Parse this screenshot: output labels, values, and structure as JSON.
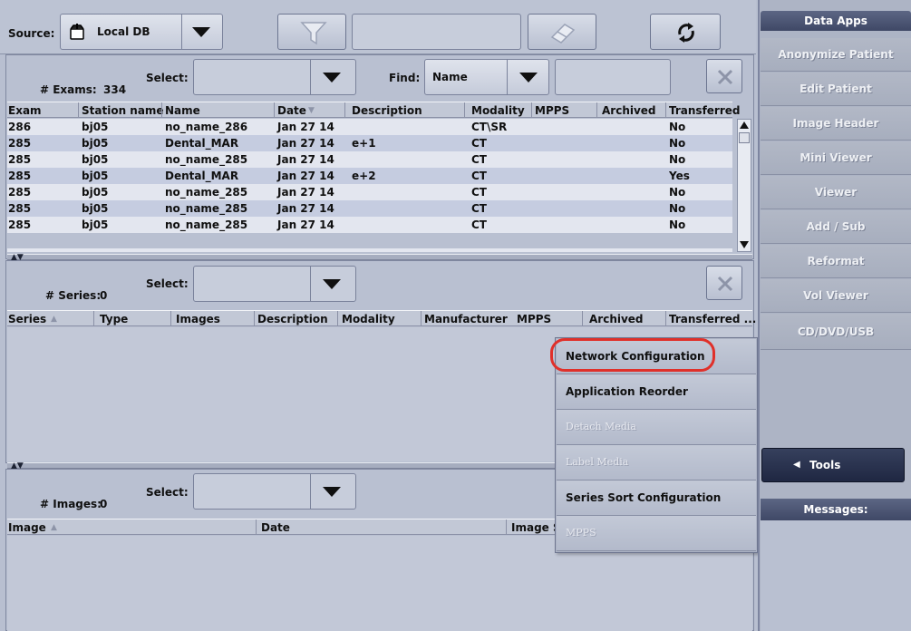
{
  "toolbar": {
    "source_label": "Source:",
    "source_value": "Local DB"
  },
  "exams": {
    "count_label": "# Exams:",
    "count": "334",
    "select_label": "Select:",
    "find_label": "Find:",
    "find_field": "Name",
    "columns": [
      "Exam",
      "Station name",
      "Name",
      "Date",
      "Description",
      "Modality",
      "MPPS",
      "Archived",
      "Transferred"
    ],
    "rows": [
      [
        "286",
        "bj05",
        "no_name_286",
        "Jan 27 14",
        "",
        "CT\\SR",
        "",
        "",
        "No"
      ],
      [
        "285",
        "bj05",
        "Dental_MAR",
        "Jan 27 14",
        "e+1",
        "CT",
        "",
        "",
        "No"
      ],
      [
        "285",
        "bj05",
        "no_name_285",
        "Jan 27 14",
        "",
        "CT",
        "",
        "",
        "No"
      ],
      [
        "285",
        "bj05",
        "Dental_MAR",
        "Jan 27 14",
        "e+2",
        "CT",
        "",
        "",
        "Yes"
      ],
      [
        "285",
        "bj05",
        "no_name_285",
        "Jan 27 14",
        "",
        "CT",
        "",
        "",
        "No"
      ],
      [
        "285",
        "bj05",
        "no_name_285",
        "Jan 27 14",
        "",
        "CT",
        "",
        "",
        "No"
      ],
      [
        "285",
        "bj05",
        "no_name_285",
        "Jan 27 14",
        "",
        "CT",
        "",
        "",
        "No"
      ]
    ]
  },
  "series": {
    "count_label": "# Series:",
    "count": "0",
    "select_label": "Select:",
    "columns": [
      "Series",
      "Type",
      "Images",
      "Description",
      "Modality",
      "Manufacturer",
      "MPPS",
      "Archived",
      "Transferred ..."
    ]
  },
  "images": {
    "count_label": "# Images:",
    "count": "0",
    "select_label": "Select:",
    "columns": [
      "Image",
      "Date",
      "Image Si"
    ]
  },
  "sidebar": {
    "header": "Data Apps",
    "items": [
      "Anonymize Patient",
      "Edit Patient",
      "Image Header",
      "Mini Viewer",
      "Viewer",
      "Add / Sub",
      "Reformat",
      "Vol Viewer",
      "CD/DVD/USB"
    ],
    "tools_label": "Tools",
    "messages_label": "Messages:"
  },
  "tools_menu": {
    "items": [
      {
        "label": "Network Configuration",
        "enabled": true,
        "highlighted": true
      },
      {
        "label": "Application Reorder",
        "enabled": true
      },
      {
        "label": "Detach Media",
        "enabled": false
      },
      {
        "label": "Label Media",
        "enabled": false
      },
      {
        "label": "Series Sort Configuration",
        "enabled": true
      },
      {
        "label": "MPPS",
        "enabled": false
      }
    ]
  },
  "colors": {
    "background": "#b8bfd0",
    "row_light": "#e3e6ef",
    "row_alt": "#c5cce0",
    "sidebar_header": "#4a5470",
    "highlight_ring": "#e0302a"
  }
}
